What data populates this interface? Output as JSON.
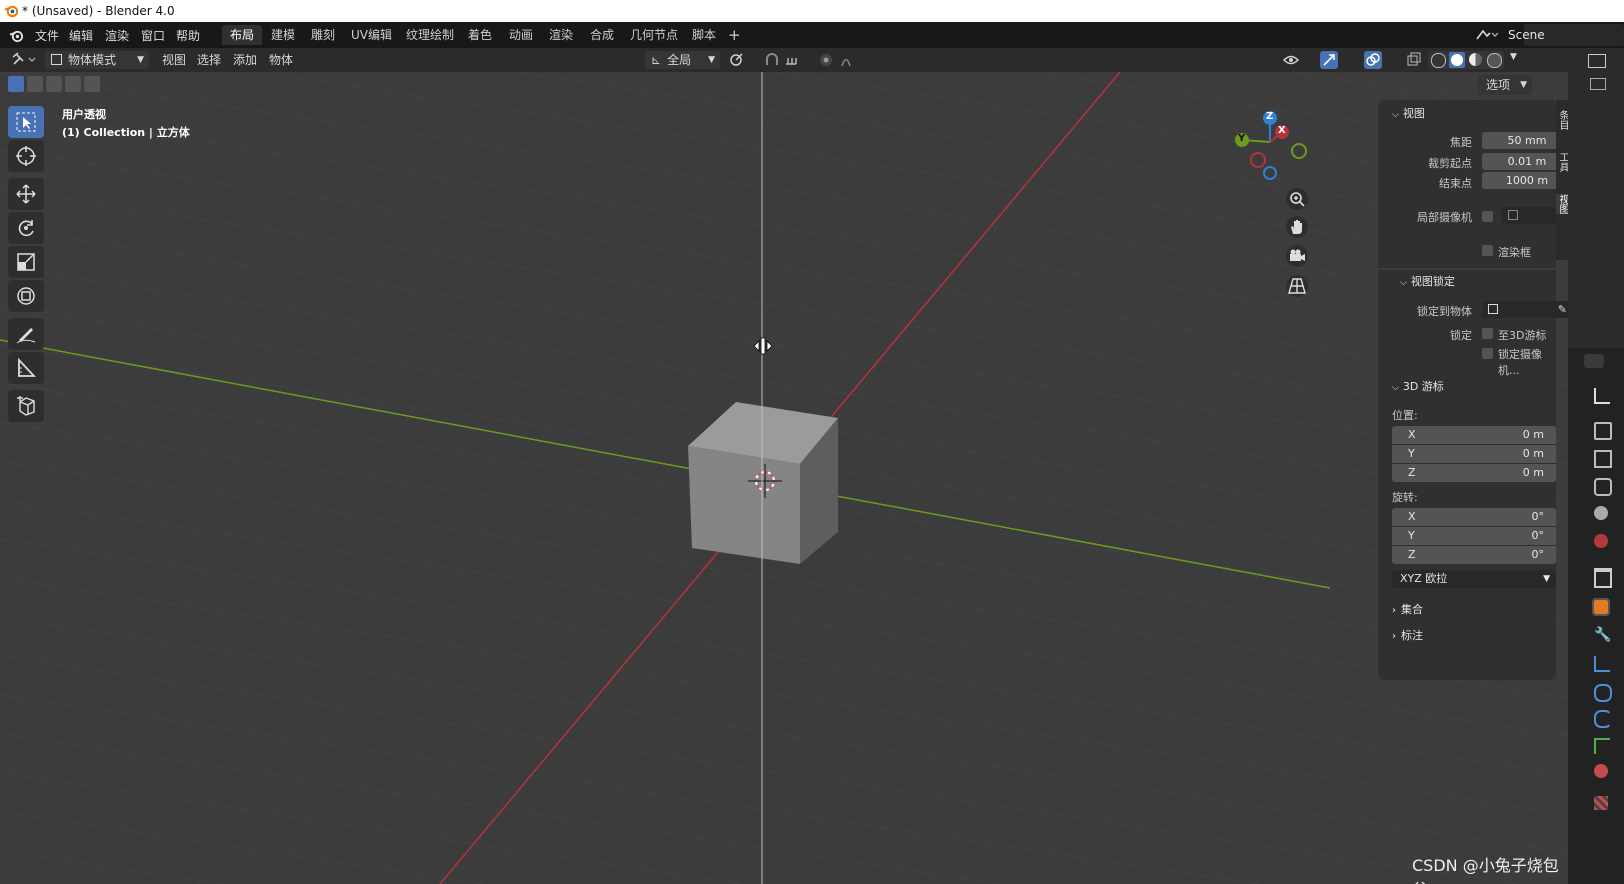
{
  "window": {
    "title": "* (Unsaved) - Blender 4.0"
  },
  "menu": {
    "items": [
      "文件",
      "编辑",
      "渲染",
      "窗口",
      "帮助"
    ]
  },
  "workspaces": {
    "tabs": [
      "布局",
      "建模",
      "雕刻",
      "UV编辑",
      "纹理绘制",
      "着色",
      "动画",
      "渲染",
      "合成",
      "几何节点",
      "脚本"
    ],
    "active": "布局",
    "add": "+"
  },
  "scene": {
    "name": "Scene"
  },
  "header": {
    "mode": "物体模式",
    "menus": [
      "视图",
      "选择",
      "添加",
      "物体"
    ],
    "orientation": "全局",
    "options": "选项"
  },
  "viewport": {
    "view_name": "用户透视",
    "collection_info": "(1) Collection | 立方体",
    "gizmo_axes": {
      "x": "X",
      "y": "Y",
      "z": "Z"
    }
  },
  "npanel": {
    "tabs": [
      "条目",
      "工具",
      "视图"
    ],
    "view_section": {
      "title": "视图",
      "focal_label": "焦距",
      "focal_value": "50 mm",
      "clip_start_label": "裁剪起点",
      "clip_start_value": "0.01 m",
      "clip_end_label": "结束点",
      "clip_end_value": "1000 m",
      "local_camera_label": "局部摄像机",
      "render_region_label": "渲染框",
      "view_lock_title": "视图锁定",
      "lock_to_object_label": "锁定到物体",
      "lock_label": "锁定",
      "lock_cursor_label": "至3D游标",
      "lock_camera_label": "锁定摄像机..."
    },
    "cursor_section": {
      "title": "3D 游标",
      "location_label": "位置:",
      "location": [
        {
          "axis": "X",
          "value": "0 m"
        },
        {
          "axis": "Y",
          "value": "0 m"
        },
        {
          "axis": "Z",
          "value": "0 m"
        }
      ],
      "rotation_label": "旋转:",
      "rotation": [
        {
          "axis": "X",
          "value": "0°"
        },
        {
          "axis": "Y",
          "value": "0°"
        },
        {
          "axis": "Z",
          "value": "0°"
        }
      ],
      "rotation_mode": "XYZ 欧拉"
    },
    "collapsed_sections": [
      "集合",
      "标注"
    ]
  },
  "watermark": "CSDN @小兔子烧包谷",
  "colors": {
    "accent": "#4772b3",
    "x_axis": "#b8323a",
    "y_axis": "#6d9a1e",
    "z_axis": "#2f7fd6"
  }
}
